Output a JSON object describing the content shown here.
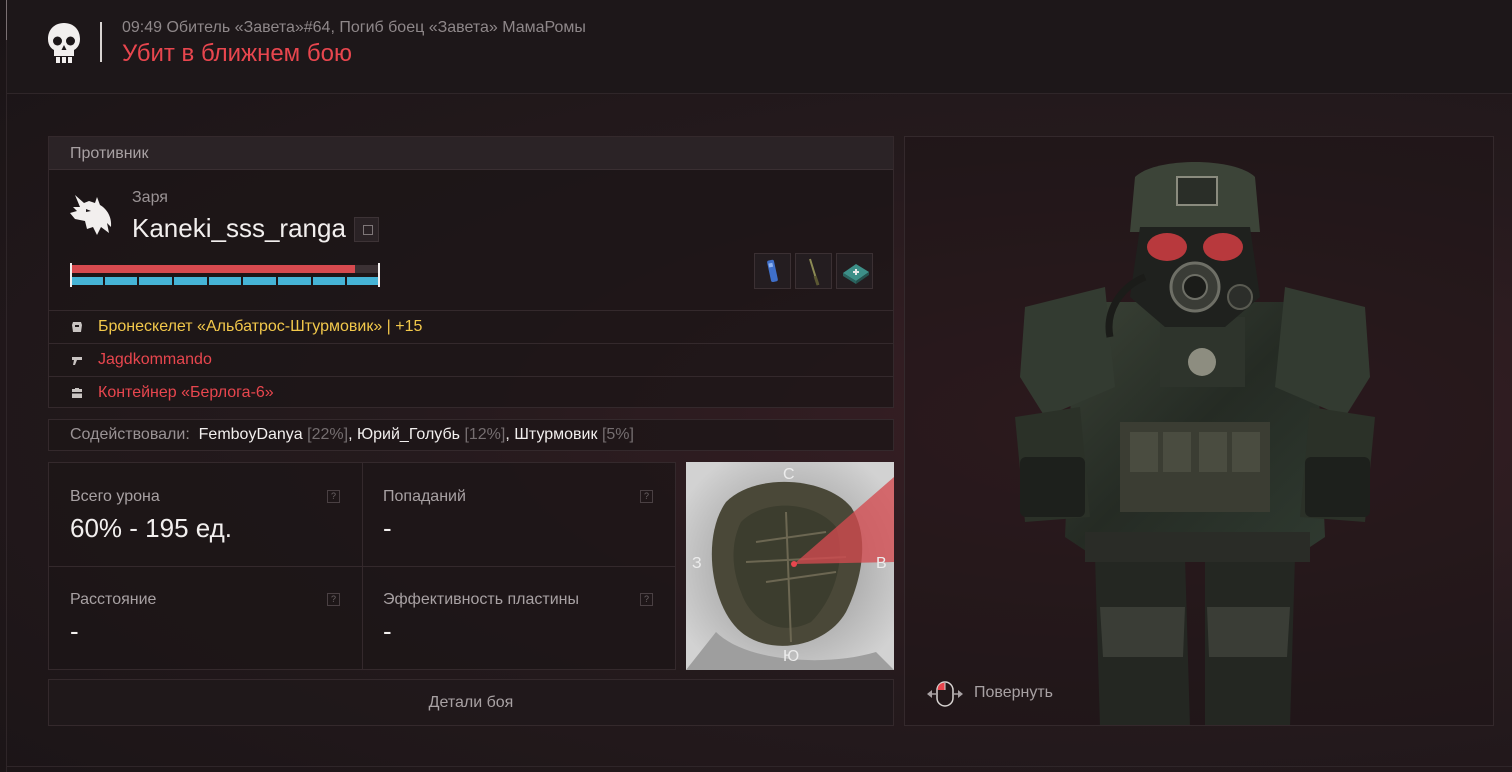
{
  "header": {
    "subtitle": "09:49 Обитель «Завета»#64, Погиб боец «Завета» МамаРомы",
    "title": "Убит в ближнем бою",
    "icon": "skull-icon"
  },
  "enemy": {
    "section_label": "Противник",
    "faction": "Заря",
    "nickname": "Kaneki_sss_ranga",
    "health_fraction": 0.92,
    "armor_segments": 9,
    "emblem_icon": "wolf-icon",
    "quick_slots": [
      "battery-icon",
      "knife-icon",
      "medkit-icon"
    ]
  },
  "gear": [
    {
      "icon": "armor-icon",
      "text": "Бронескелет «Альбатрос-Штурмовик» | +15",
      "color": "#f2c84b"
    },
    {
      "icon": "gun-icon",
      "text": "Jagdkommando",
      "color": "#e8464e"
    },
    {
      "icon": "container-icon",
      "text": "Контейнер «Берлога-6»",
      "color": "#e8464e"
    }
  ],
  "assist": {
    "label": "Содействовали:",
    "players": [
      {
        "name": "FemboyDanya",
        "pct": "[22%]",
        "sep": ","
      },
      {
        "name": "Юрий_Голубь",
        "pct": "[12%]",
        "sep": ","
      },
      {
        "name": "Штурмовик",
        "pct": "[5%]",
        "sep": ""
      }
    ]
  },
  "stats": {
    "damage_title": "Всего урона",
    "damage_value": "60% - 195 ед.",
    "hits_title": "Попаданий",
    "hits_value": "-",
    "distance_title": "Расстояние",
    "distance_value": "-",
    "plate_title": "Эффективность пластины",
    "plate_value": "-",
    "help_glyph": "?"
  },
  "minimap": {
    "north": "С",
    "south": "Ю",
    "west": "З",
    "east": "В"
  },
  "details_button": "Детали боя",
  "viewer": {
    "rotate_label": "Повернуть",
    "rotate_icon": "mouse-rotate-icon"
  }
}
